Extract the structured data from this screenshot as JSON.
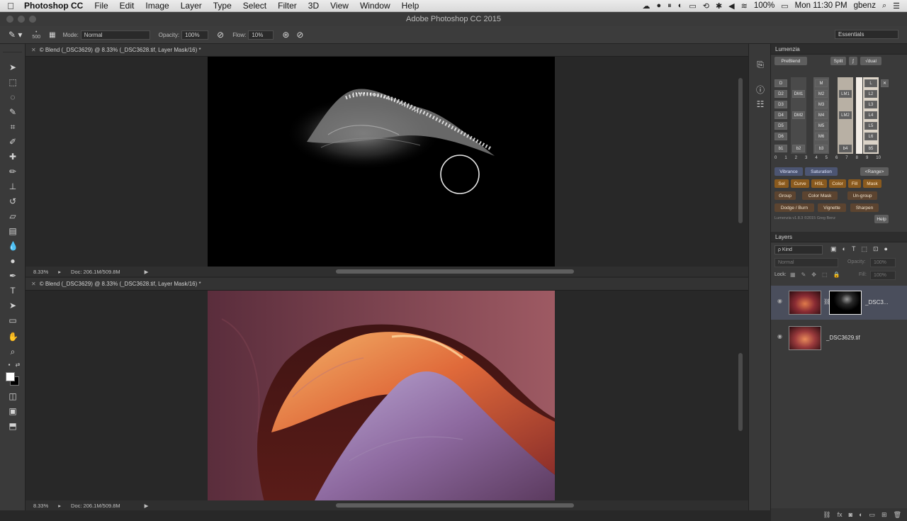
{
  "menubar": {
    "app": "Photoshop CC",
    "items": [
      "File",
      "Edit",
      "Image",
      "Layer",
      "Type",
      "Select",
      "Filter",
      "3D",
      "View",
      "Window",
      "Help"
    ],
    "battery": "100%",
    "clock": "Mon 11:30 PM",
    "user": "gbenz"
  },
  "window": {
    "title": "Adobe Photoshop CC 2015"
  },
  "options": {
    "brush_size": "500",
    "mode_label": "Mode:",
    "mode_value": "Normal",
    "opacity_label": "Opacity:",
    "opacity_value": "100%",
    "flow_label": "Flow:",
    "flow_value": "10%",
    "workspace": "Essentials"
  },
  "doc_top": {
    "tab": "© Blend (_DSC3629) @ 8.33% (_DSC3628.tif, Layer Mask/16) *",
    "zoom": "8.33%",
    "doc_size": "Doc: 206.1M/509.8M"
  },
  "doc_bottom": {
    "tab": "© Blend (_DSC3629) @ 8.33% (_DSC3628.tif, Layer Mask/16) *",
    "zoom": "8.33%",
    "doc_size": "Doc: 206.1M/509.8M"
  },
  "lumenzia": {
    "title": "Lumenzia",
    "preblend": "PreBlend",
    "split": "Split",
    "zone": "√dual",
    "d_col": [
      "D",
      "D2",
      "D3",
      "D4",
      "D5",
      "D6"
    ],
    "dm_col": [
      "DM1",
      "DM2"
    ],
    "m_col": [
      "M",
      "M2",
      "M3",
      "M4",
      "M5",
      "M6"
    ],
    "lm_col": [
      "LM1",
      "LM2"
    ],
    "l_col": [
      "L",
      "L2",
      "L3",
      "L4",
      "L5",
      "L6"
    ],
    "bottom_row": [
      "b1",
      "b2",
      "b3",
      "b4",
      "b5"
    ],
    "nums": [
      "0",
      "1",
      "2",
      "3",
      "4",
      "5",
      "6",
      "7",
      "8",
      "9",
      "10"
    ],
    "vibrance": "Vibrance",
    "saturation": "Saturation",
    "range": "<Range>",
    "row_orange": [
      "Sel",
      "Curve",
      "HSL",
      "Color",
      "Fill",
      "Mask"
    ],
    "group": "Group",
    "color_mask": "Color Mask",
    "ungroup": "Un-group",
    "dodge_burn": "Dodge / Burn",
    "vignette": "Vignette",
    "sharpen": "Sharpen",
    "version": "Lumenzia v1.8.3 ©2015 Greg Benz",
    "help": "Help"
  },
  "layers": {
    "title": "Layers",
    "filter": "ρ Kind",
    "blend": "Normal",
    "opacity_label": "Opacity:",
    "opacity_value": "100%",
    "lock_label": "Lock:",
    "fill_label": "Fill:",
    "fill_value": "100%",
    "rows": [
      {
        "name": "_DSC3..."
      },
      {
        "name": "_DSC3629.tif"
      }
    ]
  }
}
